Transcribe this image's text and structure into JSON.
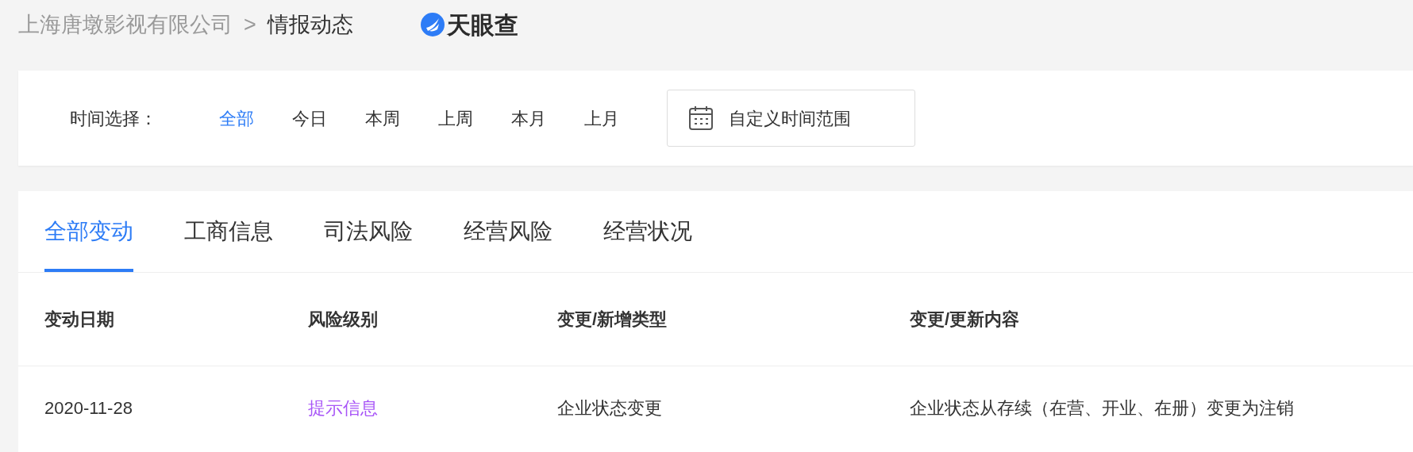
{
  "breadcrumb": {
    "company": "上海唐墩影视有限公司",
    "separator": ">",
    "current": "情报动态"
  },
  "logo": {
    "text": "天眼查"
  },
  "time_filter": {
    "label": "时间选择：",
    "options": [
      {
        "label": "全部",
        "selected": true
      },
      {
        "label": "今日",
        "selected": false
      },
      {
        "label": "本周",
        "selected": false
      },
      {
        "label": "上周",
        "selected": false
      },
      {
        "label": "本月",
        "selected": false
      },
      {
        "label": "上月",
        "selected": false
      }
    ],
    "custom_button": "自定义时间范围"
  },
  "tabs": [
    {
      "label": "全部变动",
      "selected": true
    },
    {
      "label": "工商信息",
      "selected": false
    },
    {
      "label": "司法风险",
      "selected": false
    },
    {
      "label": "经营风险",
      "selected": false
    },
    {
      "label": "经营状况",
      "selected": false
    }
  ],
  "table": {
    "columns": [
      "变动日期",
      "风险级别",
      "变更/新增类型",
      "变更/更新内容"
    ],
    "rows": [
      {
        "date": "2020-11-28",
        "risk_level": {
          "text": "提示信息",
          "color": "#a855f7"
        },
        "type": "企业状态变更",
        "content": "企业状态从存续（在营、开业、在册）变更为注销"
      }
    ]
  }
}
